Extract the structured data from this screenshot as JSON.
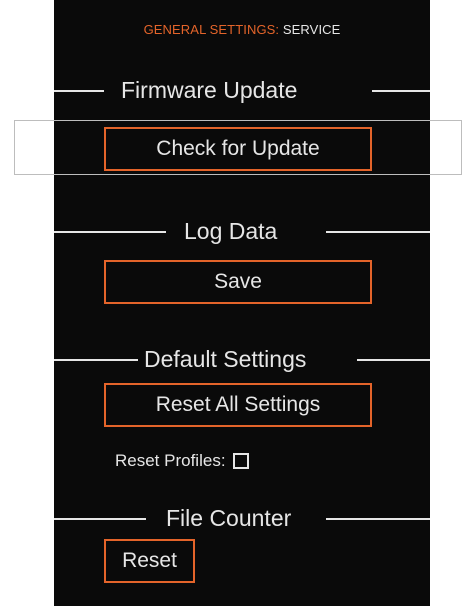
{
  "header": {
    "category": "GENERAL SETTINGS:",
    "page": "SERVICE"
  },
  "sections": {
    "firmware": {
      "title": "Firmware Update",
      "button": "Check for Update"
    },
    "log": {
      "title": "Log Data",
      "button": "Save"
    },
    "defaults": {
      "title": "Default Settings",
      "button": "Reset All Settings",
      "checkbox_label": "Reset Profiles:"
    },
    "counter": {
      "title": "File Counter",
      "button": "Reset"
    }
  },
  "colors": {
    "accent": "#e4642a",
    "text": "#e6e6e6",
    "background": "#0a0a0a"
  },
  "state": {
    "reset_profiles_checked": false
  }
}
